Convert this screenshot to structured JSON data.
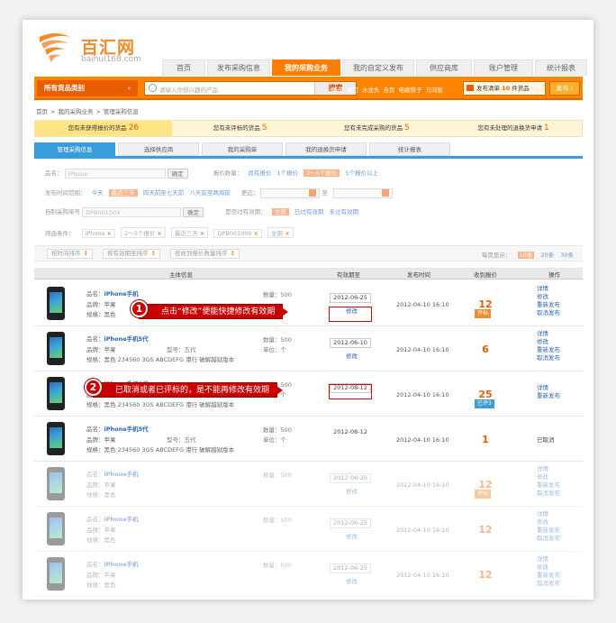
{
  "logo": {
    "name": "百汇网",
    "domain": "baihui168.com"
  },
  "nav_tabs": [
    "首页",
    "发布采购信息",
    "我的采购业务",
    "我的自定义发布",
    "供应商库",
    "账户管理",
    "统计报表"
  ],
  "nav_active": 2,
  "topbar": {
    "category_label": "所有货品类别",
    "search_placeholder": "请输入你想兴趣的产品",
    "search_button": "搜索",
    "hot_words": [
      "螺母",
      "螺钉",
      "水龙头",
      "合页",
      "电磁铁子",
      "万向轮"
    ],
    "cart_prefix": "发布清单",
    "cart_count": "10",
    "cart_suffix": "件货品",
    "publish_button": "发布 ›"
  },
  "breadcrumb": [
    "首页",
    ">",
    "我的采购业务",
    ">",
    "管理采购信息"
  ],
  "notices": [
    {
      "text": "您有未获得报价的货品",
      "count": "26"
    },
    {
      "text": "您有未评标的货品",
      "count": "5"
    },
    {
      "text": "您有未完成采购的货品",
      "count": "5"
    },
    {
      "text": "您有未处理的退换货申请",
      "count": "1"
    }
  ],
  "sub_tabs": [
    "管理采购信息",
    "选择供应商",
    "我的采购单",
    "我的退换货申请",
    "统计报表"
  ],
  "filters": {
    "name_label": "品名：",
    "name_value": "iPhone",
    "confirm": "确定",
    "quote_count_label": "报价数量：",
    "quote_options": [
      "尚有报价",
      "1个报价",
      "2～5个报价",
      "5个报价以上"
    ],
    "time_label": "发布时间范围：",
    "time_options": [
      "今天",
      "最近三天",
      "四天前至七天前",
      "八天前至两周前"
    ],
    "earlier_label": "更远：",
    "to_label": "至",
    "id_label": "自制采购单号",
    "id_value": "DPB001009",
    "expired_label": "是否过有效期：",
    "expired_options": [
      "全部",
      "已过有效期",
      "未过有效期"
    ],
    "selected_label": "筛选条件：",
    "selected_tags": [
      "iPhone",
      "2～5个报价",
      "最近三天",
      "DPB001009",
      "全部"
    ]
  },
  "sort": {
    "buttons": [
      "按时间排序",
      "按有效期至排序",
      "按收到报价数量排序"
    ],
    "page_size_label": "每页显示：",
    "page_sizes": [
      "10条",
      "20条",
      "30条"
    ]
  },
  "table_headers": [
    "主体信息",
    "有效期至",
    "发布时间",
    "收到报价",
    "操作"
  ],
  "rows": [
    {
      "name": "iPhone手机",
      "brand": "苹果",
      "spec": "黑色",
      "model": "",
      "qty": "500",
      "unit": "",
      "expire": "2012-06-25",
      "edit": "修改",
      "published": "2012-04-10 16:10",
      "quotes": "12",
      "badge": "评标",
      "ops": [
        "详情",
        "修改",
        "重新发布",
        "取消发布"
      ],
      "faded": false
    },
    {
      "name": "iPhone手机5代",
      "brand": "苹果",
      "spec": "黑色 234560 3GS ABCDEFG 港行 破解越狱版本",
      "model": "五代",
      "qty": "500",
      "unit": "个",
      "expire": "2012-06-10",
      "edit": "修改",
      "published": "2012-04-10 16:10",
      "quotes": "6",
      "badge": "",
      "ops": [
        "详情",
        "修改",
        "重新发布",
        "取消发布"
      ],
      "faded": false
    },
    {
      "name": "iPhone手机5代",
      "brand": "苹果",
      "spec": "黑色 234560 3GS ABCDEFG 港行 破解越狱版本",
      "model": "五代",
      "qty": "500",
      "unit": "个",
      "expire": "2012-08-12",
      "edit": "",
      "published": "2012-04-10 16:10",
      "quotes": "25",
      "badge": "已评3",
      "ops": [
        "详情",
        "重新发布"
      ],
      "faded": false
    },
    {
      "name": "iPhone手机5代",
      "brand": "苹果",
      "spec": "黑色 234560 3GS ABCDEFG 港行 破解越狱版本",
      "model": "五代",
      "qty": "500",
      "unit": "个",
      "expire": "2012-08-12",
      "edit": "",
      "published": "2012-04-10 16:10",
      "quotes": "1",
      "badge": "",
      "ops": [
        "已取消"
      ],
      "faded": false
    },
    {
      "name": "iPhone手机",
      "brand": "苹果",
      "spec": "黑色",
      "model": "",
      "qty": "500",
      "unit": "",
      "expire": "2012-06-25",
      "edit": "修改",
      "published": "2012-04-10 16:10",
      "quotes": "12",
      "badge": "评标",
      "ops": [
        "详情",
        "修改",
        "重新发布",
        "取消发布"
      ],
      "faded": true
    },
    {
      "name": "iPhone手机",
      "brand": "苹果",
      "spec": "黑色",
      "model": "",
      "qty": "500",
      "unit": "",
      "expire": "2012-06-25",
      "edit": "修改",
      "published": "2012-04-10 16:10",
      "quotes": "12",
      "badge": "",
      "ops": [
        "详情",
        "修改",
        "重新发布",
        "取消发布"
      ],
      "faded": true
    },
    {
      "name": "iPhone手机",
      "brand": "苹果",
      "spec": "黑色",
      "model": "",
      "qty": "500",
      "unit": "",
      "expire": "2012-06-25",
      "edit": "修改",
      "published": "2012-04-10 16:10",
      "quotes": "12",
      "badge": "",
      "ops": [
        "详情",
        "修改",
        "重新发布",
        "取消发布"
      ],
      "faded": true
    }
  ],
  "row_labels": {
    "name": "品名：",
    "brand": "品牌：",
    "spec": "规格：",
    "model": "型号：",
    "qty": "数量：",
    "unit": "单位："
  },
  "callouts": [
    {
      "num": "1",
      "text": "点击“修改”便能快捷修改有效期"
    },
    {
      "num": "2",
      "text": "已取消或者已评标的，是不能再修改有效期"
    }
  ],
  "colors": {
    "brand_orange": "#ff8400",
    "tab_blue": "#3a9cd8",
    "callout_red": "#c80000"
  }
}
